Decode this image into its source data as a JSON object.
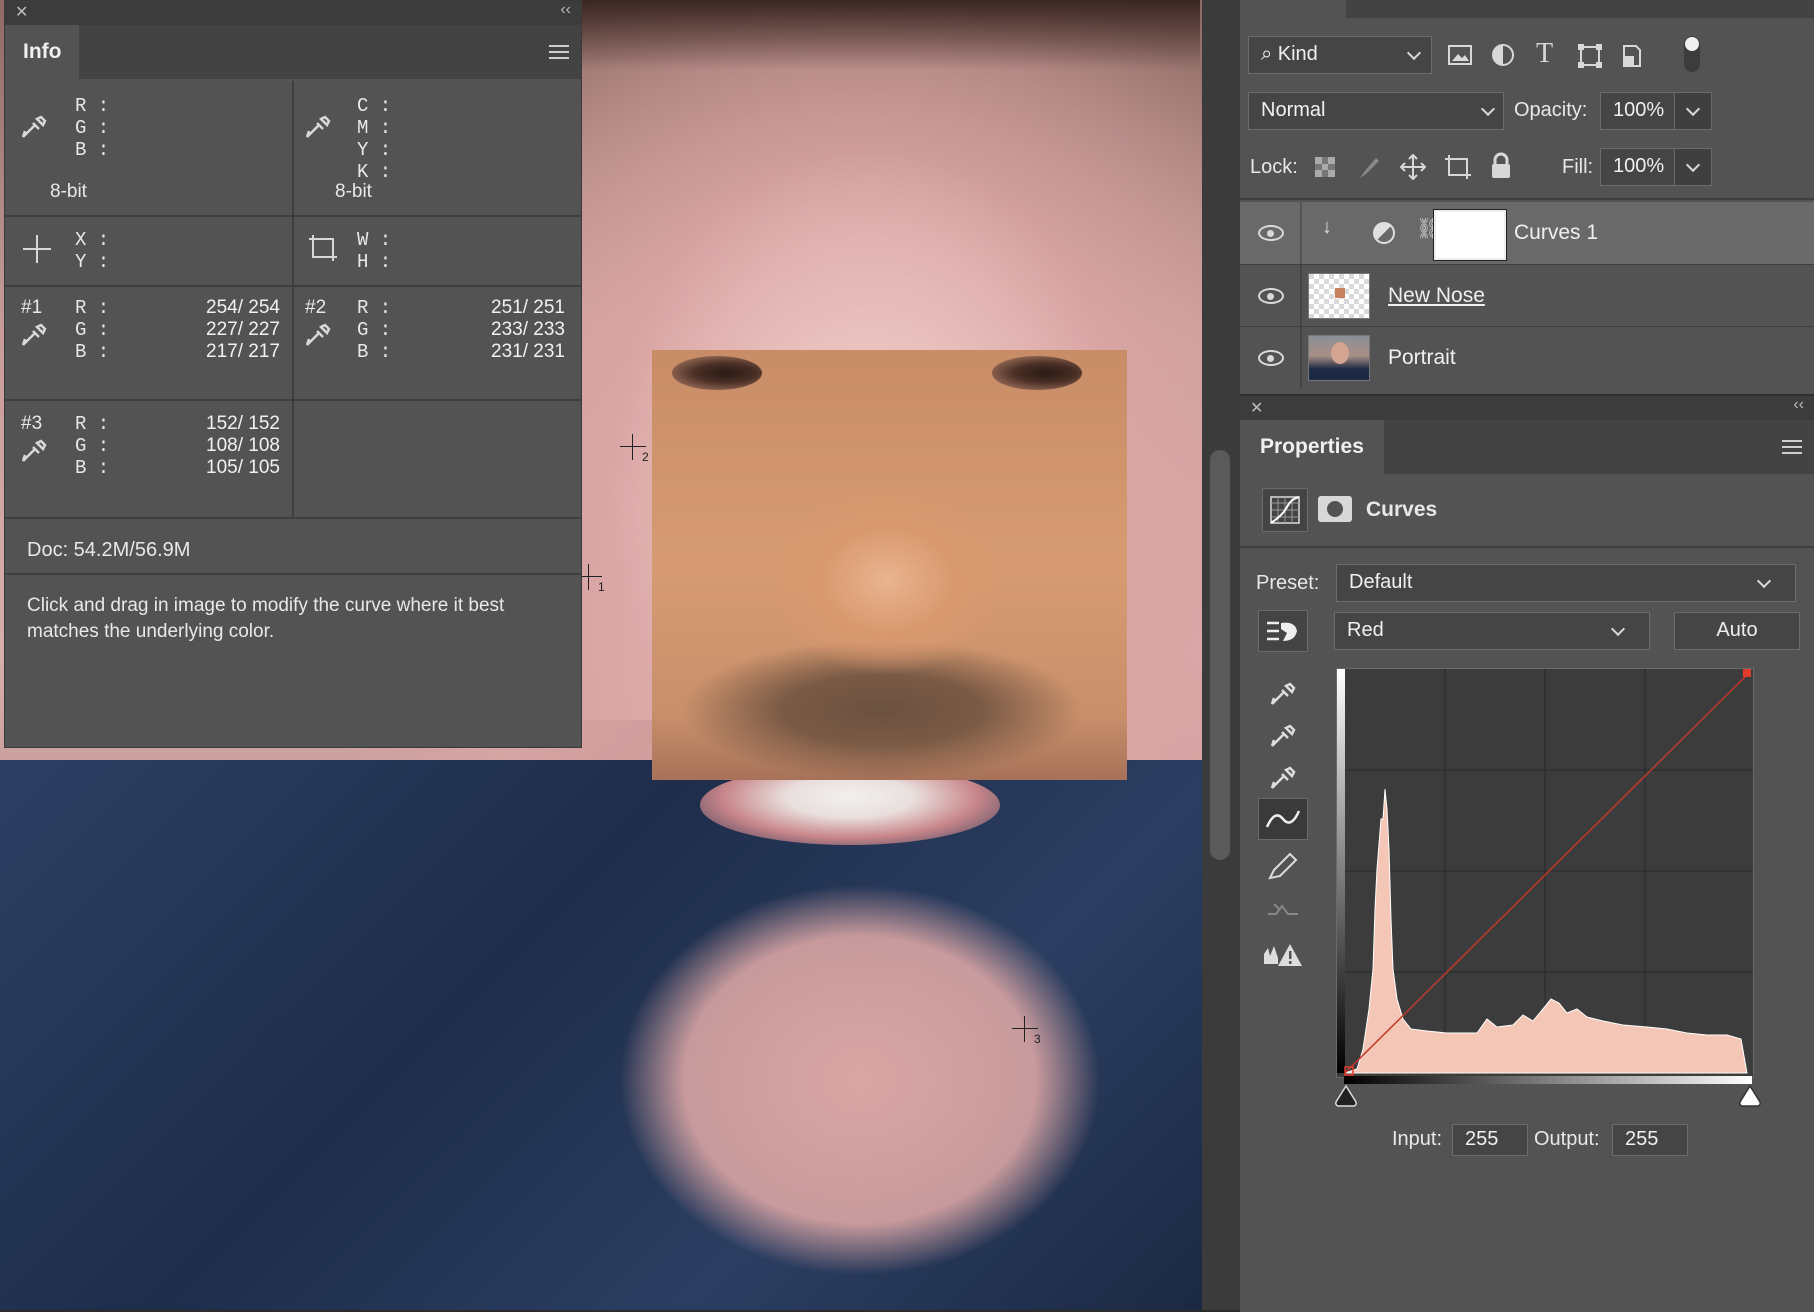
{
  "info_panel": {
    "tab": "Info",
    "rgb_labels": [
      "R :",
      "G :",
      "B :"
    ],
    "cmyk_labels": [
      "C :",
      "M :",
      "Y :",
      "K :"
    ],
    "bit_depth_left": "8-bit",
    "bit_depth_right": "8-bit",
    "xy_labels": [
      "X :",
      "Y :"
    ],
    "wh_labels": [
      "W :",
      "H :"
    ],
    "samplers": [
      {
        "id": "#1",
        "values": [
          "254/  254",
          "227/  227",
          "217/  217"
        ]
      },
      {
        "id": "#2",
        "values": [
          "251/  251",
          "233/  233",
          "231/  231"
        ]
      },
      {
        "id": "#3",
        "values": [
          "152/  152",
          "108/  108",
          "105/  105"
        ]
      }
    ],
    "doc": "Doc: 54.2M/56.9M",
    "hint": "Click and drag in image to modify the curve where it best matches the underlying color."
  },
  "canvas": {
    "sampler_labels": [
      "2",
      "1",
      "3"
    ]
  },
  "layers_panel": {
    "filter_kind": "Kind",
    "blend_mode": "Normal",
    "opacity_label": "Opacity:",
    "opacity": "100%",
    "lock_label": "Lock:",
    "fill_label": "Fill:",
    "fill": "100%",
    "layers": [
      {
        "name": "Curves 1",
        "selected": true
      },
      {
        "name": "New Nose",
        "selected": false
      },
      {
        "name": "Portrait",
        "selected": false
      }
    ]
  },
  "properties_panel": {
    "tab": "Properties",
    "adjustment": "Curves",
    "preset_label": "Preset:",
    "preset": "Default",
    "channel": "Red",
    "auto_label": "Auto",
    "input_label": "Input:",
    "input_value": "255",
    "output_label": "Output:",
    "output_value": "255",
    "curve_color": "#c0392b",
    "histogram_color": "#f4c6b6"
  }
}
